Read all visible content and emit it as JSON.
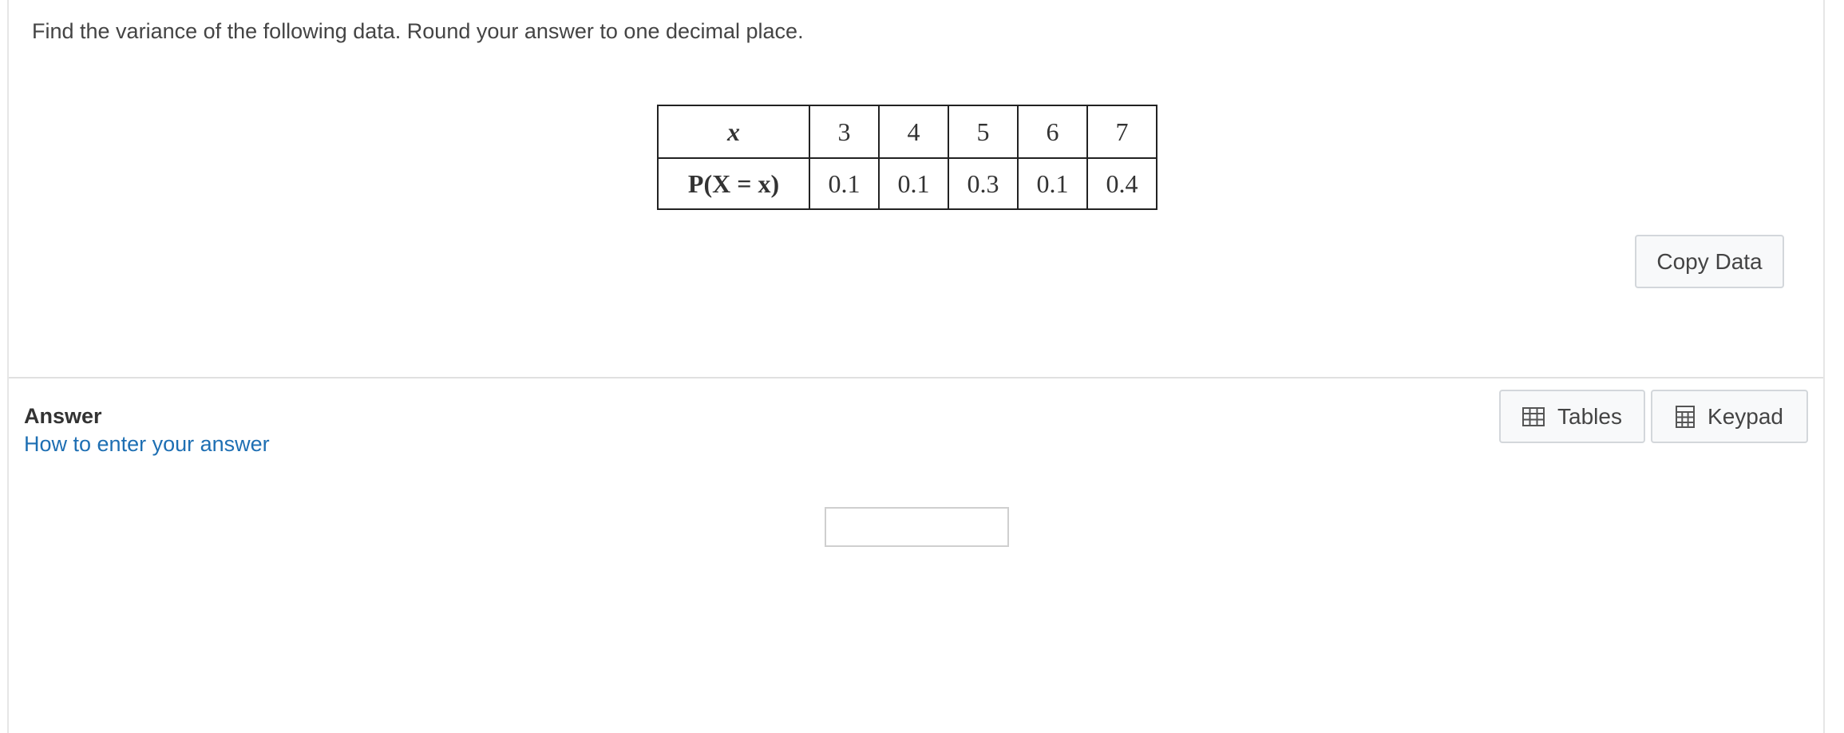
{
  "question": {
    "text": "Find the variance of the following data. Round your answer to one decimal place."
  },
  "data_table": {
    "x_label": "x",
    "p_label": "P(X = x)",
    "x_values": [
      "3",
      "4",
      "5",
      "6",
      "7"
    ],
    "p_values": [
      "0.1",
      "0.1",
      "0.3",
      "0.1",
      "0.4"
    ]
  },
  "buttons": {
    "copy_data": "Copy Data",
    "tables": "Tables",
    "keypad": "Keypad"
  },
  "icons": {
    "tables": "table-grid-icon",
    "keypad": "calculator-icon"
  },
  "answer": {
    "heading": "Answer",
    "help_link": "How to enter your answer",
    "value": ""
  },
  "colors": {
    "link": "#1e6fb3",
    "button_bg": "#f8f9fa",
    "button_border": "#d3d7db"
  }
}
